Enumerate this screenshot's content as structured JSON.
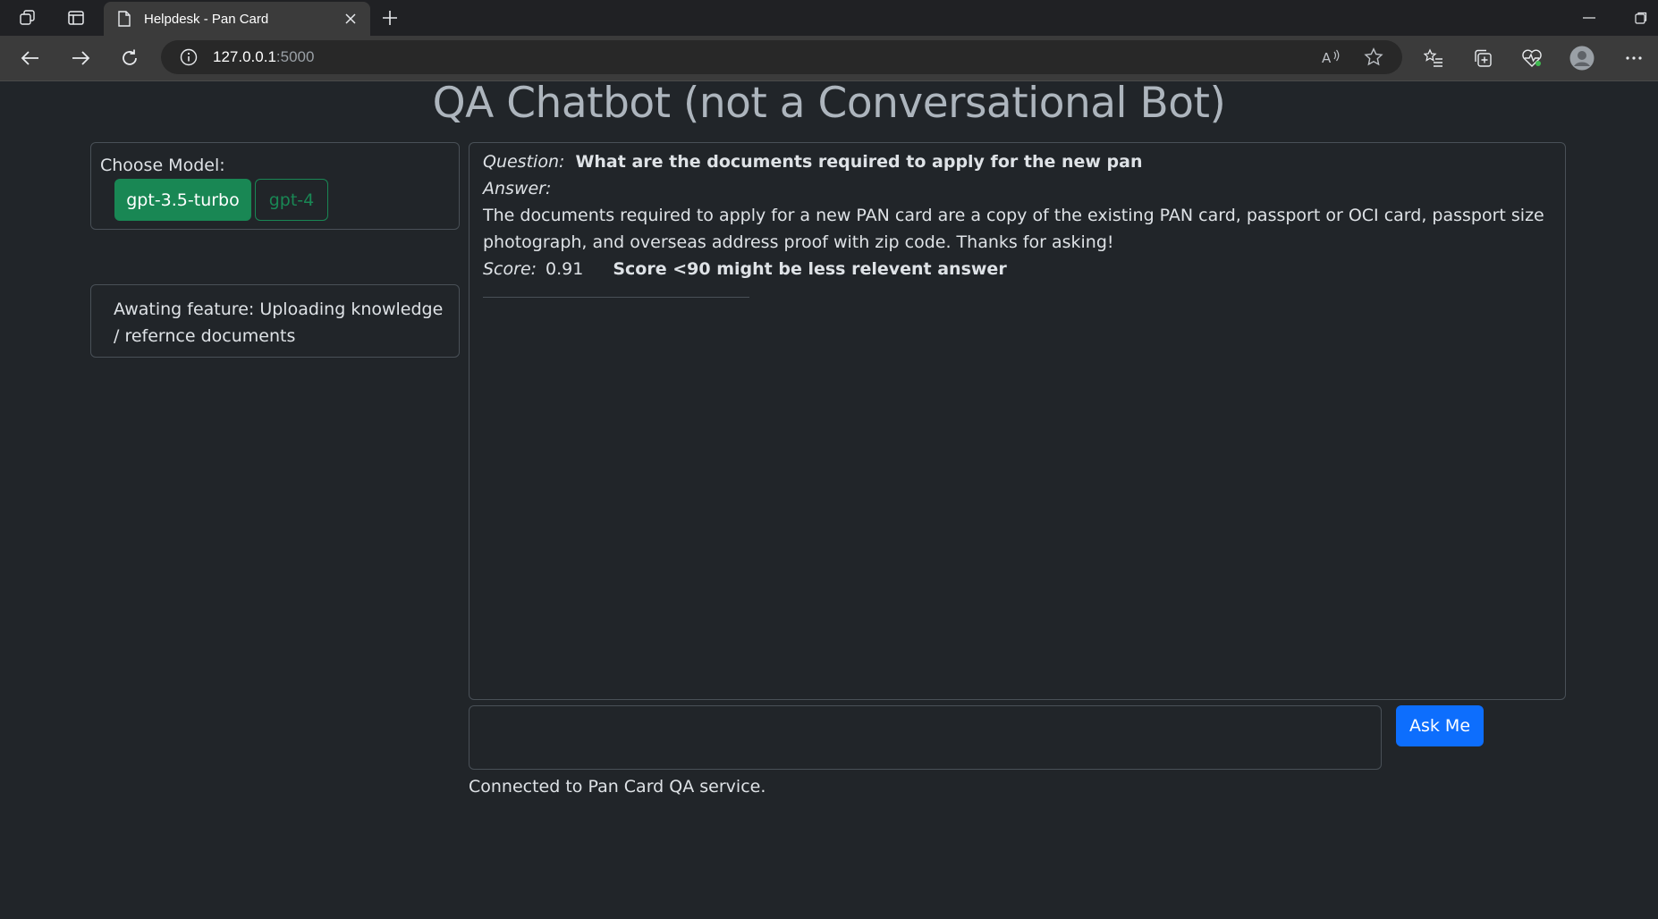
{
  "browser": {
    "tab_title": "Helpdesk - Pan Card",
    "url_host": "127.0.0.1",
    "url_port": ":5000"
  },
  "page": {
    "title": "QA Chatbot (not a Conversational Bot)"
  },
  "model_panel": {
    "label": "Choose Model:",
    "options": [
      "gpt-3.5-turbo",
      "gpt-4"
    ],
    "selected": "gpt-3.5-turbo"
  },
  "feature_panel": {
    "text": "Awating feature: Uploading knowledge / refernce documents"
  },
  "chat": {
    "question_label": "Question:",
    "question": "What are the documents required to apply for the new pan",
    "answer_label": "Answer:",
    "answer": "The documents required to apply for a new PAN card are a copy of the existing PAN card, passport or OCI card, passport size photograph, and overseas address proof with zip code. Thanks for asking!",
    "score_label": "Score:",
    "score": "0.91",
    "score_note": "Score <90 might be less relevent answer"
  },
  "input": {
    "value": "",
    "ask_label": "Ask Me"
  },
  "status": {
    "text": "Connected to Pan Card QA service."
  },
  "colors": {
    "page_bg": "#212529",
    "success": "#198754",
    "primary": "#0d6efd"
  }
}
